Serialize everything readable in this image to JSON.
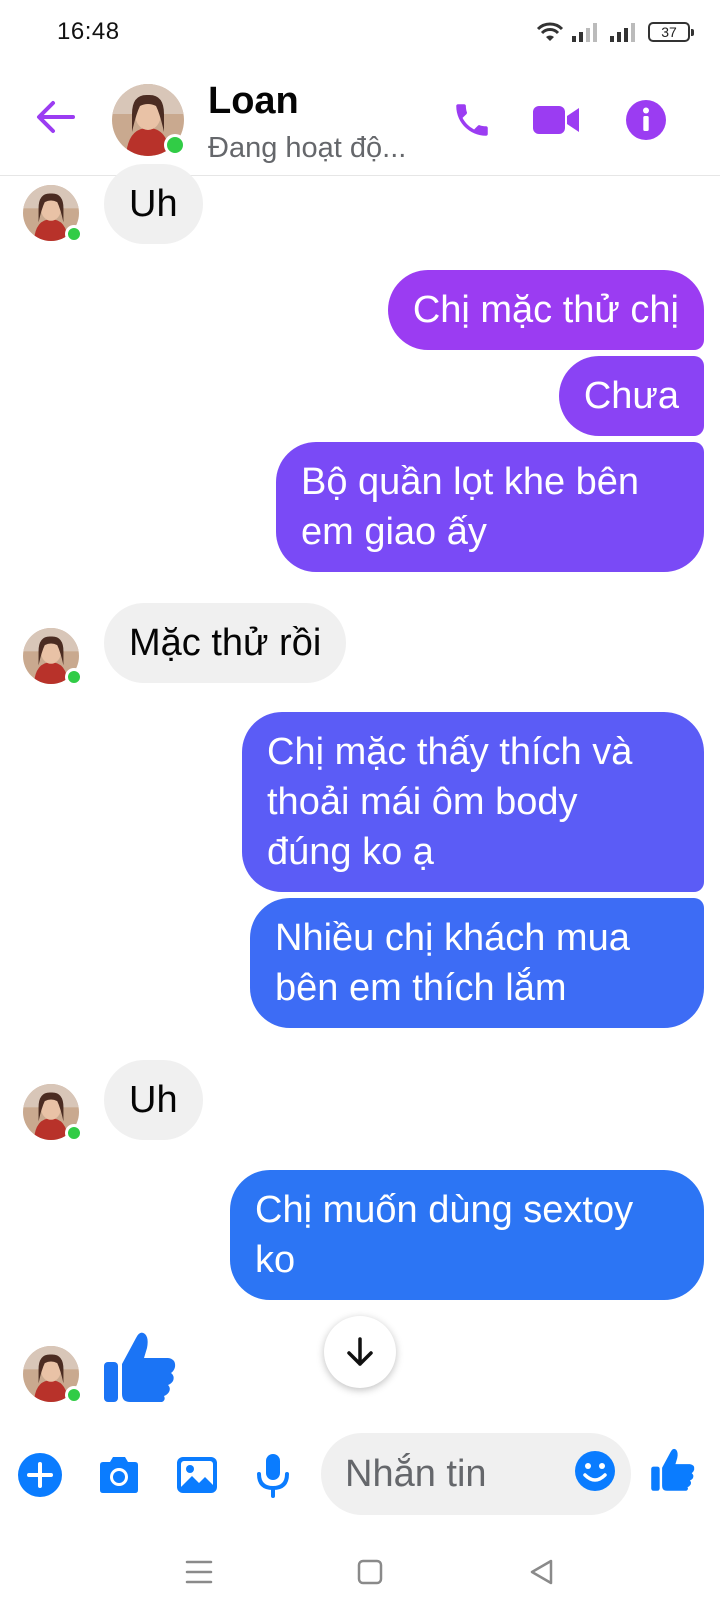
{
  "status_bar": {
    "time": "16:48",
    "battery": "37",
    "icons": [
      "wifi-icon",
      "signal-icon",
      "signal-icon",
      "battery-icon"
    ]
  },
  "header": {
    "back_icon": "arrow-left-icon",
    "contact_name": "Loan",
    "contact_status": "Đang hoạt độ...",
    "actions": [
      "phone-icon",
      "video-camera-icon",
      "info-icon"
    ]
  },
  "colors": {
    "accent_purple": "#9b3cf2",
    "online_green": "#31cc46",
    "incoming_bubble": "#f0f0f0",
    "outgoing_gradient": [
      "#9b3cf2",
      "#7a4af6",
      "#5b5cf6",
      "#3d6cf5",
      "#2c75f4"
    ],
    "composer_blue": "#0a7cff"
  },
  "messages": [
    {
      "direction": "incoming",
      "text": "Uh"
    },
    {
      "direction": "outgoing",
      "text": "Chị mặc thử chị"
    },
    {
      "direction": "outgoing",
      "text": "Chưa"
    },
    {
      "direction": "outgoing",
      "lines": [
        "Bộ quần lọt khe bên",
        "em giao ấy"
      ]
    },
    {
      "direction": "incoming",
      "text": "Mặc thử rồi"
    },
    {
      "direction": "outgoing",
      "lines": [
        "Chị mặc thấy thích và",
        "thoải mái ôm body",
        "đúng ko ạ"
      ]
    },
    {
      "direction": "outgoing",
      "lines": [
        "Nhiều chị khách mua",
        "bên em thích lắm"
      ]
    },
    {
      "direction": "incoming",
      "text": "Uh"
    },
    {
      "direction": "outgoing",
      "lines": [
        "Chị muốn dùng sextoy",
        "ko"
      ]
    },
    {
      "direction": "incoming",
      "sticker": "thumbs-up-icon"
    }
  ],
  "scroll_down_icon": "arrow-down-icon",
  "composer": {
    "icons": [
      "plus-icon",
      "camera-icon",
      "image-icon",
      "microphone-icon"
    ],
    "placeholder": "Nhắn tin",
    "emoji_icon": "smiley-icon",
    "send_icon": "thumbs-up-icon"
  },
  "nav_bar": {
    "buttons": [
      "menu-icon",
      "home-icon",
      "back-triangle-icon"
    ]
  }
}
